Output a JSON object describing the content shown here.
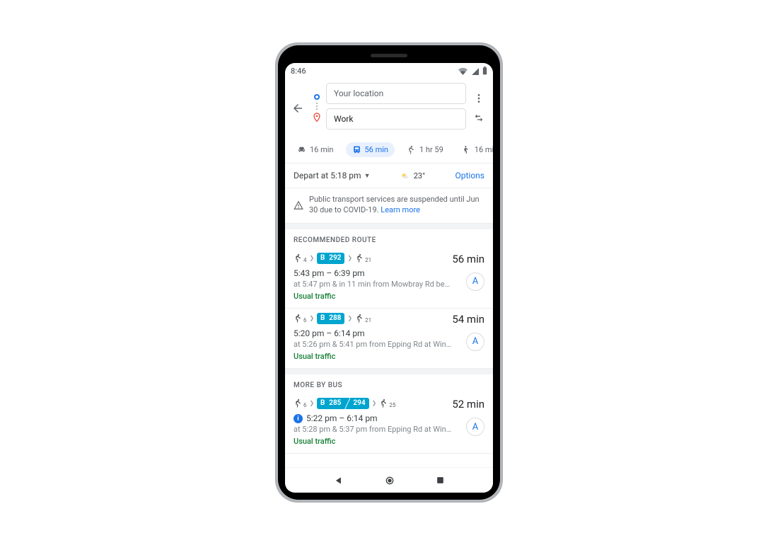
{
  "statusbar": {
    "time": "8:46"
  },
  "header": {
    "origin_field": "Your location",
    "destination_field": "Work"
  },
  "modes": {
    "car": {
      "label": "16 min"
    },
    "transit": {
      "label": "56 min"
    },
    "walk": {
      "label": "1 hr 59"
    },
    "rideshare": {
      "label": "16 mi"
    }
  },
  "subbar": {
    "depart_label": "Depart at 5:18 pm",
    "temp": "23°",
    "options_label": "Options"
  },
  "alert": {
    "text": "Public transport services are suspended until Jun 30 due to COVID-19.",
    "learn_more": "Learn more"
  },
  "sections": {
    "recommended": "RECOMMENDED ROUTE",
    "more_bus": "MORE BY BUS"
  },
  "routes": [
    {
      "walk1": "4",
      "bus_label": "B",
      "bus_numbers": [
        "292"
      ],
      "walk2": "21",
      "duration": "56 min",
      "times": "5:43 pm – 6:39 pm",
      "note": "at 5:47 pm & in 11 min from Mowbray Rd bef…",
      "traffic": "Usual traffic",
      "accessible": {
        "glyph": "A"
      },
      "has_info": false
    },
    {
      "walk1": "6",
      "bus_label": "B",
      "bus_numbers": [
        "288"
      ],
      "walk2": "21",
      "duration": "54 min",
      "times": "5:20 pm – 6:14 pm",
      "note": "at 5:26 pm & 5:41 pm from Epping Rd at Win…",
      "traffic": "Usual traffic",
      "accessible": {
        "glyph": "A"
      },
      "has_info": false
    },
    {
      "walk1": "6",
      "bus_label": "B",
      "bus_numbers": [
        "285",
        "294"
      ],
      "walk2": "25",
      "duration": "52 min",
      "times": "5:22 pm – 6:14 pm",
      "note": "at 5:28 pm & 5:37 pm from Epping Rd at Win…",
      "traffic": "Usual traffic",
      "accessible": {
        "glyph": "A"
      },
      "has_info": true
    }
  ]
}
